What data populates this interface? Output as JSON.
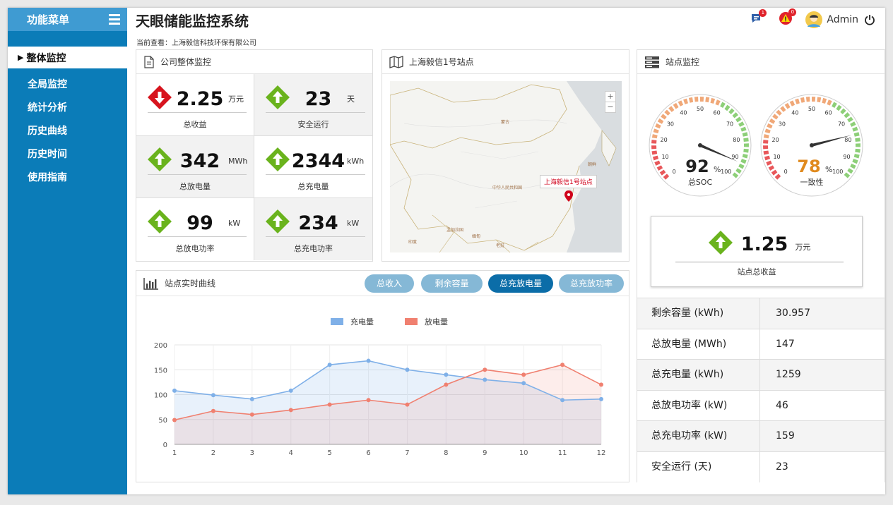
{
  "sidebar": {
    "title": "功能菜单",
    "active": "整体监控",
    "items": [
      "全局监控",
      "统计分析",
      "历史曲线",
      "历史时间",
      "使用指南"
    ]
  },
  "header": {
    "title": "天眼储能监控系统",
    "messages_count": "1",
    "alerts_count": "0",
    "user": "Admin"
  },
  "viewing": "当前查看：上海毅信科技环保有限公司",
  "overall": {
    "title": "公司整体监控",
    "cards": [
      {
        "value": "2.25",
        "unit": "万元",
        "label": "总收益",
        "trend": "down"
      },
      {
        "value": "23",
        "unit": "天",
        "label": "安全运行",
        "trend": "up"
      },
      {
        "value": "342",
        "unit": "MWh",
        "label": "总放电量",
        "trend": "up"
      },
      {
        "value": "2344",
        "unit": "kWh",
        "label": "总充电量",
        "trend": "up"
      },
      {
        "value": "99",
        "unit": "kW",
        "label": "总放电功率",
        "trend": "up"
      },
      {
        "value": "234",
        "unit": "kW",
        "label": "总充电功率",
        "trend": "up"
      }
    ]
  },
  "map": {
    "title": "上海毅信1号站点",
    "marker_label": "上海毅信1号站点",
    "zoom_in": "+",
    "zoom_out": "−",
    "place_labels": [
      "蒙古",
      "中华人民共和国",
      "朝鲜",
      "孟加拉国",
      "缅甸",
      "老挝",
      "印度"
    ]
  },
  "curve": {
    "title": "站点实时曲线",
    "tabs": [
      {
        "label": "总收入",
        "active": false
      },
      {
        "label": "剩余容量",
        "active": false
      },
      {
        "label": "总充放电量",
        "active": true
      },
      {
        "label": "总充放功率",
        "active": false
      }
    ]
  },
  "chart_data": {
    "type": "line",
    "x": [
      1,
      2,
      3,
      4,
      5,
      6,
      7,
      8,
      9,
      10,
      11,
      12
    ],
    "series": [
      {
        "name": "充电量",
        "color": "#7fb0e8",
        "values": [
          108,
          99,
          91,
          108,
          160,
          168,
          150,
          140,
          130,
          123,
          89,
          91
        ]
      },
      {
        "name": "放电量",
        "color": "#f08070",
        "values": [
          49,
          67,
          60,
          69,
          80,
          89,
          80,
          120,
          150,
          140,
          160,
          120
        ]
      }
    ],
    "ylim": [
      0,
      200
    ],
    "yticks": [
      0,
      50,
      100,
      150,
      200
    ],
    "grid": true,
    "legend": "top-center",
    "area": true
  },
  "station": {
    "title": "站点监控",
    "gauges": [
      {
        "value": 92,
        "unit": "%",
        "label": "总SOC",
        "value_color": "#222"
      },
      {
        "value": 78,
        "unit": "%",
        "label": "一致性",
        "value_color": "#e08a1e"
      }
    ],
    "gauge_ticks": [
      "0",
      "10",
      "20",
      "30",
      "40",
      "50",
      "60",
      "70",
      "80",
      "90",
      "100"
    ],
    "income": {
      "value": "1.25",
      "unit": "万元",
      "label": "站点总收益"
    },
    "table": [
      {
        "label": "剩余容量 (kWh)",
        "value": "30.957"
      },
      {
        "label": "总放电量 (MWh)",
        "value": "147"
      },
      {
        "label": "总充电量 (kWh)",
        "value": "1259"
      },
      {
        "label": "总放电功率 (kW)",
        "value": "46"
      },
      {
        "label": "总充电功率 (kW)",
        "value": "159"
      },
      {
        "label": "安全运行 (天)",
        "value": "23"
      }
    ]
  }
}
